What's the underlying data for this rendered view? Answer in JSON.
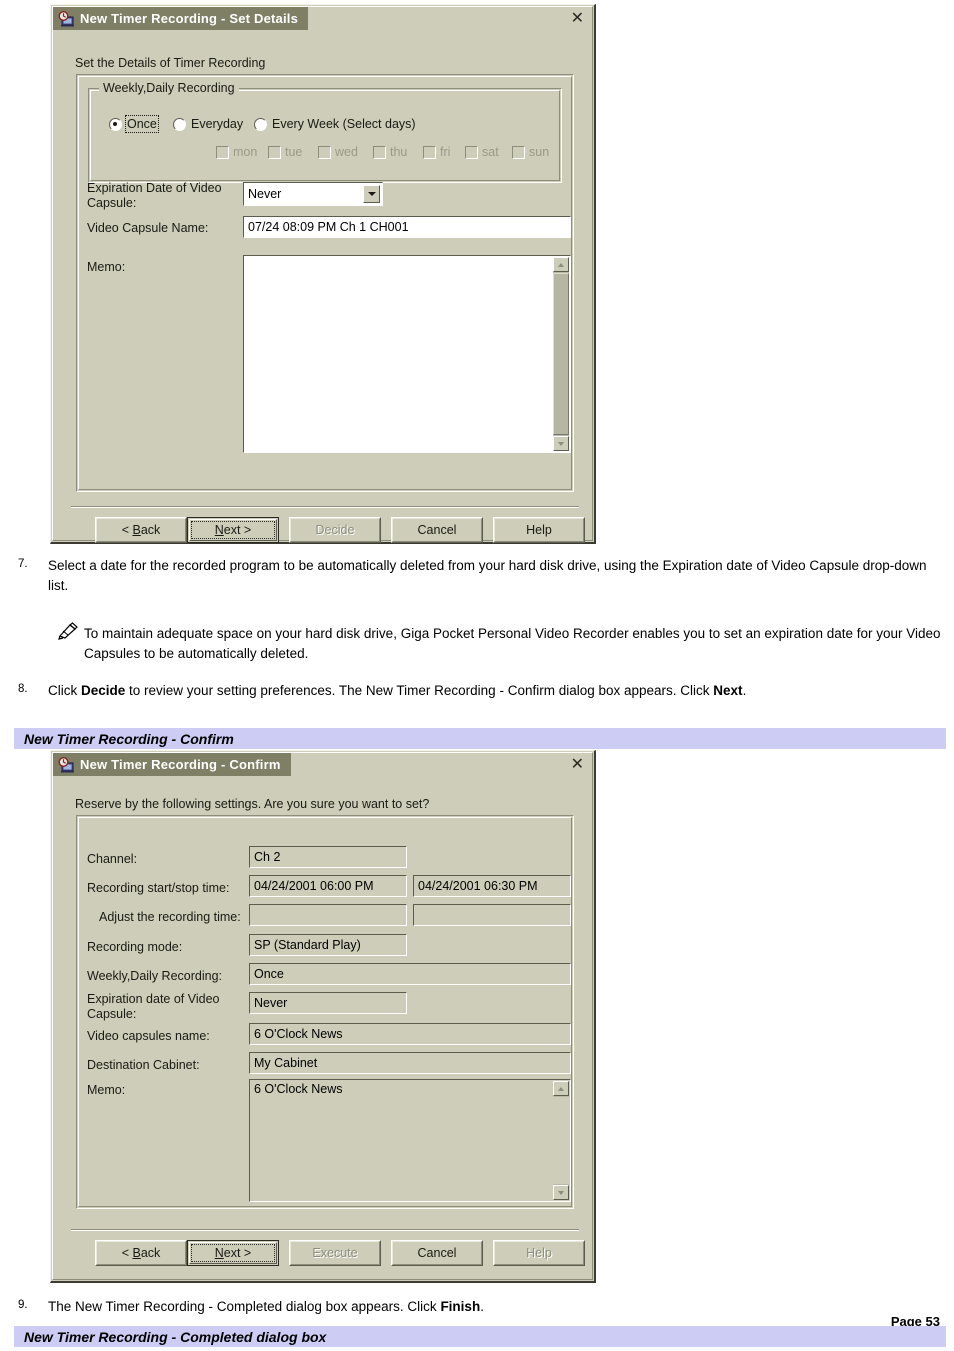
{
  "page": {
    "page_label": "Page 53"
  },
  "dialog1": {
    "title": "New Timer Recording - Set Details",
    "icon": "timer-clock-monitor-icon",
    "close_label": "✕",
    "section_label": "Set the Details of Timer Recording",
    "group_title": "Weekly,Daily Recording",
    "radios": [
      {
        "label": "Once",
        "selected": true,
        "focused": true
      },
      {
        "label": "Everyday",
        "selected": false,
        "focused": false
      },
      {
        "label": "Every Week (Select days)",
        "selected": false,
        "focused": false
      }
    ],
    "day_checkboxes": [
      {
        "label": "mon",
        "checked": false,
        "disabled": true
      },
      {
        "label": "tue",
        "checked": false,
        "disabled": true
      },
      {
        "label": "wed",
        "checked": false,
        "disabled": true
      },
      {
        "label": "thu",
        "checked": false,
        "disabled": true
      },
      {
        "label": "fri",
        "checked": false,
        "disabled": true
      },
      {
        "label": "sat",
        "checked": false,
        "disabled": true
      },
      {
        "label": "sun",
        "checked": false,
        "disabled": true
      }
    ],
    "expiration_label_line1": "Expiration Date of Video",
    "expiration_label_line2": "Capsule:",
    "expiration_value": "Never",
    "capsule_name_label": "Video Capsule Name:",
    "capsule_name_value": "07/24 08:09 PM Ch 1 CH001",
    "memo_label": "Memo:",
    "memo_value": "",
    "buttons": [
      {
        "label": "< Back",
        "accel": "B",
        "state": "normal"
      },
      {
        "label": "Next >",
        "accel": "N",
        "state": "default"
      },
      {
        "label": "Decide",
        "accel": "",
        "state": "disabled"
      },
      {
        "label": "Cancel",
        "accel": "",
        "state": "normal"
      },
      {
        "label": "Help",
        "accel": "",
        "state": "normal"
      }
    ]
  },
  "step7": {
    "number": "7.",
    "text": "Select a date for the recorded program to be automatically deleted from your hard disk drive, using the Expiration date of Video Capsule drop-down list."
  },
  "note": {
    "icon": "pencil-note-icon",
    "text": "To maintain adequate space on your hard disk drive, Giga Pocket Personal Video Recorder enables you to set an expiration date for your Video Capsules to be automatically deleted."
  },
  "step8": {
    "number": "8.",
    "part1": "Click ",
    "bold1": "Decide",
    "part2": " to review your setting preferences. The New Timer Recording - Confirm dialog box appears. Click ",
    "bold2": "Next",
    "part3": "."
  },
  "bluebar1": {
    "label": "New Timer Recording - Confirm"
  },
  "dialog2": {
    "title": "New Timer Recording - Confirm",
    "icon": "timer-clock-monitor-icon",
    "close_label": "✕",
    "section_label": "Reserve by the following settings. Are you sure you want to set?",
    "fields": [
      {
        "label": "Channel:",
        "value": "Ch 2"
      },
      {
        "label": "Recording start/stop time:",
        "value": "04/24/2001 06:00 PM",
        "value2": "04/24/2001 06:30 PM"
      },
      {
        "label": "Adjust the recording time:",
        "value": "",
        "value2": ""
      },
      {
        "label": "Recording mode:",
        "value": "SP (Standard Play)"
      },
      {
        "label": "Weekly,Daily Recording:",
        "value": "Once"
      },
      {
        "label": "Expiration date of Video",
        "label2": "Capsule:",
        "value": "Never"
      },
      {
        "label": "Video capsules name:",
        "value": "6 O'Clock News"
      },
      {
        "label": "Destination Cabinet:",
        "value": "My Cabinet"
      }
    ],
    "memo_label": "Memo:",
    "memo_value": "6 O'Clock News",
    "buttons": [
      {
        "label": "< Back",
        "accel": "B",
        "state": "normal"
      },
      {
        "label": "Next >",
        "accel": "N",
        "state": "default"
      },
      {
        "label": "Execute",
        "accel": "",
        "state": "disabled"
      },
      {
        "label": "Cancel",
        "accel": "",
        "state": "normal"
      },
      {
        "label": "Help",
        "accel": "",
        "state": "disabled"
      }
    ]
  },
  "step9": {
    "number": "9.",
    "part1": "The New Timer Recording - Completed dialog box appears. Click ",
    "bold1": "Finish",
    "part2": "."
  },
  "bluebar2": {
    "label": "New Timer Recording - Completed dialog box"
  },
  "colors": {
    "dialog_face": "#cdcdba",
    "titlebar_active": "#7f7f66",
    "bluebar": "#ccccf4",
    "field_bg": "#ffffff"
  }
}
